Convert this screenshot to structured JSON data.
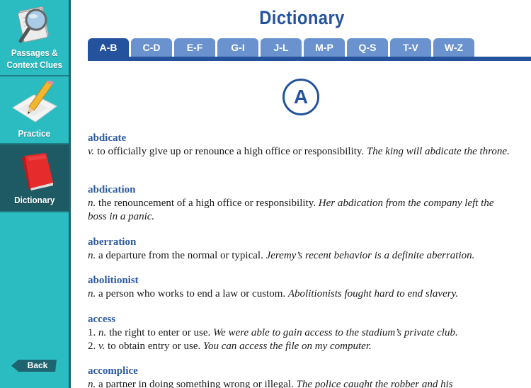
{
  "sidebar": {
    "items": [
      {
        "label_line1": "Passages &",
        "label_line2": "Context Clues",
        "icon": "magnifier-on-papers-icon",
        "active": false
      },
      {
        "label": "Practice",
        "icon": "pencil-on-paper-icon",
        "active": false
      },
      {
        "label": "Dictionary",
        "icon": "red-book-icon",
        "active": true
      }
    ],
    "back_label": "Back"
  },
  "header": {
    "title": "Dictionary"
  },
  "tabs": [
    {
      "label": "A-B",
      "active": true
    },
    {
      "label": "C-D",
      "active": false
    },
    {
      "label": "E-F",
      "active": false
    },
    {
      "label": "G-I",
      "active": false
    },
    {
      "label": "J-L",
      "active": false
    },
    {
      "label": "M-P",
      "active": false
    },
    {
      "label": "Q-S",
      "active": false
    },
    {
      "label": "T-V",
      "active": false
    },
    {
      "label": "W-Z",
      "active": false
    }
  ],
  "section_letter": "A",
  "entries": [
    {
      "term": "abdicate",
      "senses": [
        {
          "num": "",
          "pos": "v.",
          "def": " to officially give up or renounce a high office or responsibility. ",
          "example": "The king will abdicate the throne."
        }
      ]
    },
    {
      "term": "abdication",
      "senses": [
        {
          "num": "",
          "pos": "n.",
          "def": " the renouncement of a high office or responsibility. ",
          "example": "Her abdication from the company left the boss in a panic."
        }
      ]
    },
    {
      "term": "aberration",
      "senses": [
        {
          "num": "",
          "pos": "n.",
          "def": " a departure from the normal or typical. ",
          "example": "Jeremy’s recent behavior is a definite aberration."
        }
      ]
    },
    {
      "term": "abolitionist",
      "senses": [
        {
          "num": "",
          "pos": "n.",
          "def": " a person who works to end a law or custom. ",
          "example": "Abolitionists fought hard to end slavery."
        }
      ]
    },
    {
      "term": "access",
      "senses": [
        {
          "num": "1. ",
          "pos": "n.",
          "def": " the right to enter or use. ",
          "example": "We were able to gain access to the stadium’s private club."
        },
        {
          "num": "2. ",
          "pos": "v.",
          "def": " to obtain entry or use. ",
          "example": "You can access the file on my computer."
        }
      ]
    },
    {
      "term": "accomplice",
      "senses": [
        {
          "num": "",
          "pos": "n.",
          "def": " a partner in doing something wrong or illegal. ",
          "example": "The police caught the robber and his"
        }
      ]
    }
  ],
  "colors": {
    "sidebar_bg": "#2bbcc1",
    "sidebar_active_bg": "#1e5a64",
    "brand_blue": "#24529c",
    "tab_inactive": "#6a92cf",
    "term_blue": "#2d5aa0"
  }
}
